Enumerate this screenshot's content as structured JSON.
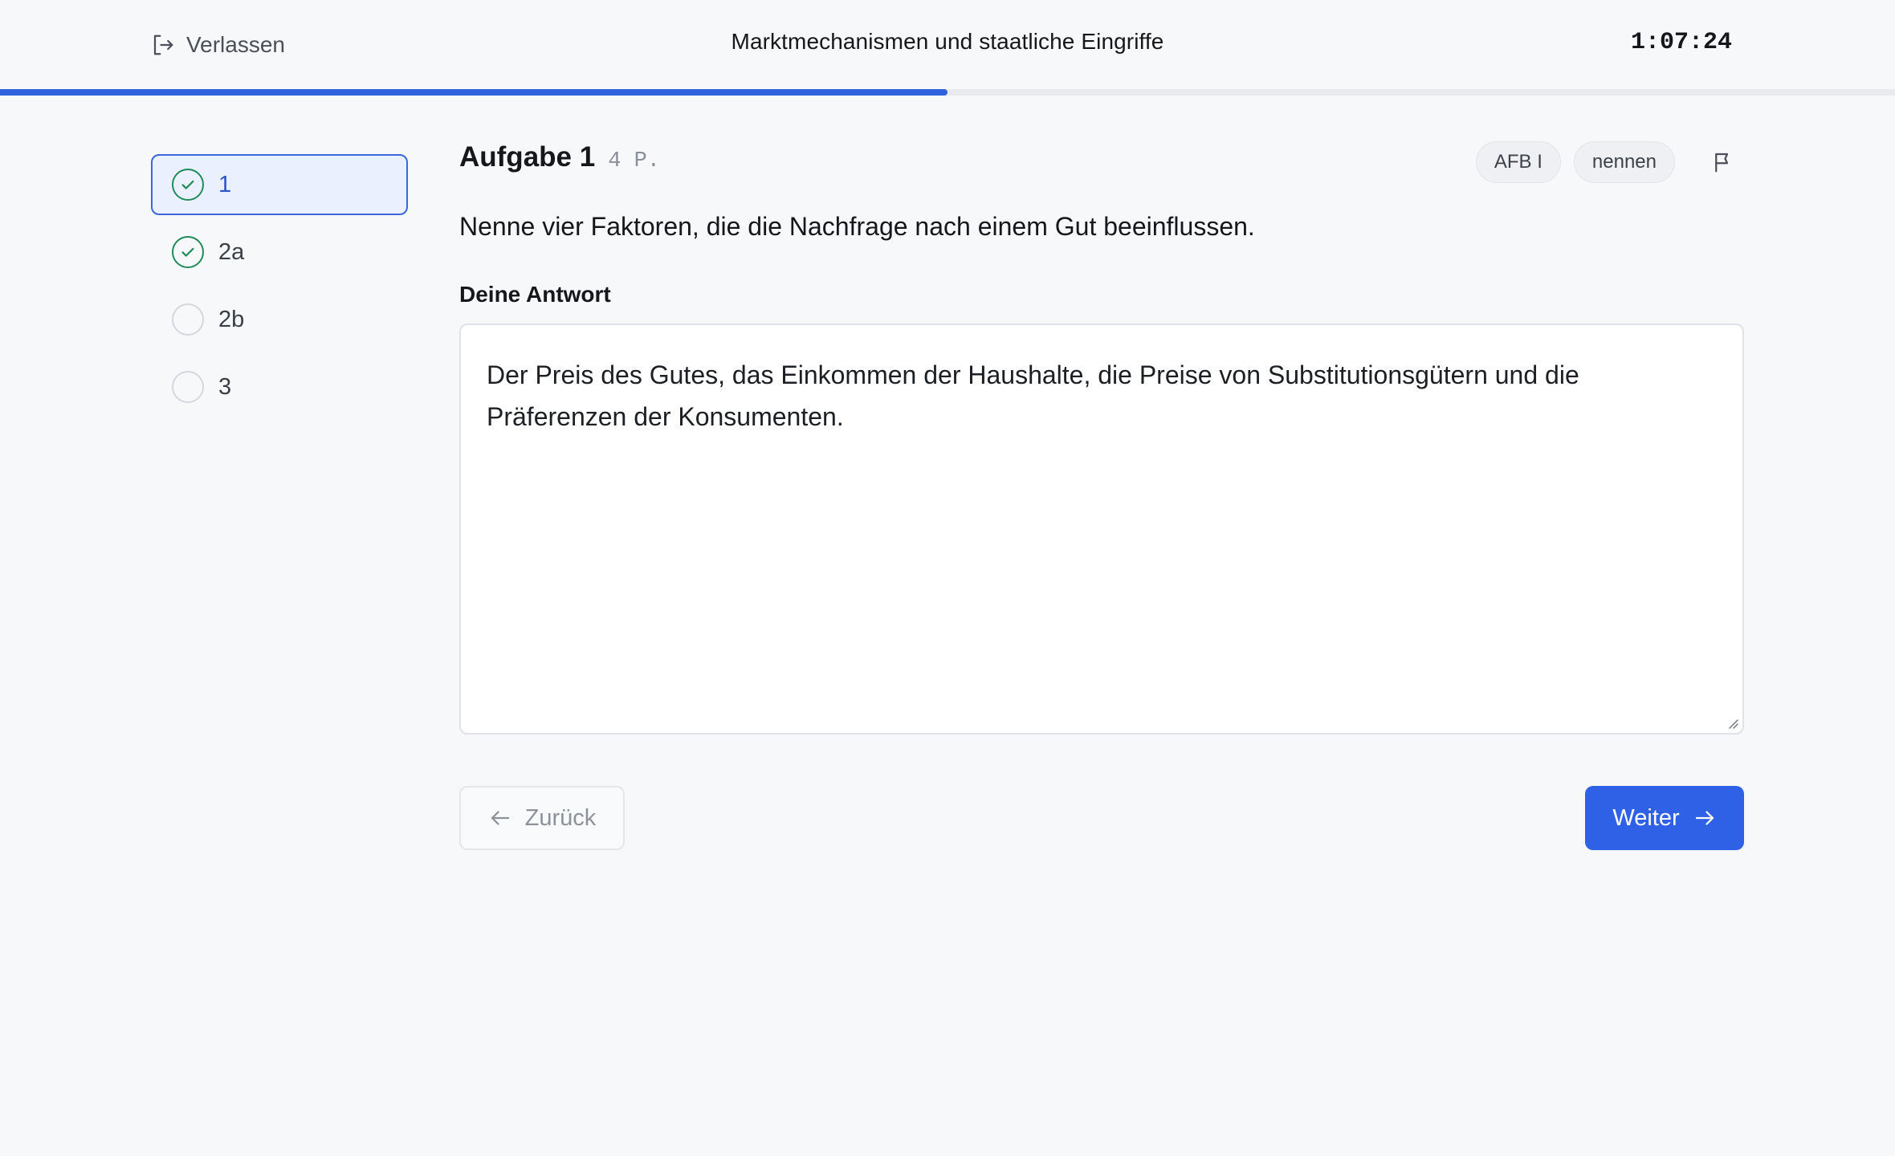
{
  "header": {
    "leave_label": "Verlassen",
    "title": "Marktmechanismen und staatliche Eingriffe",
    "timer": "1:07:24",
    "progress": 0.5
  },
  "sidebar": {
    "items": [
      {
        "label": "1",
        "done": true,
        "active": true
      },
      {
        "label": "2a",
        "done": true,
        "active": false
      },
      {
        "label": "2b",
        "done": false,
        "active": false
      },
      {
        "label": "3",
        "done": false,
        "active": false
      }
    ]
  },
  "task": {
    "title": "Aufgabe 1",
    "points": "4 P.",
    "tags": [
      "AFB I",
      "nennen"
    ],
    "question": "Nenne vier Faktoren, die die Nachfrage nach einem Gut beeinflussen.",
    "answer_label": "Deine Antwort",
    "answer_value": "Der Preis des Gutes, das Einkommen der Haushalte, die Preise von Substitutionsgütern und die Präferenzen der Konsumenten."
  },
  "nav": {
    "back_label": "Zurück",
    "next_label": "Weiter"
  },
  "colors": {
    "accent": "#2f61e6",
    "done": "#1f8c5a"
  },
  "icons": {
    "leave": "log-out-icon",
    "flag": "flag-icon",
    "back": "arrow-left-icon",
    "next": "arrow-right-icon",
    "done": "check-icon"
  }
}
